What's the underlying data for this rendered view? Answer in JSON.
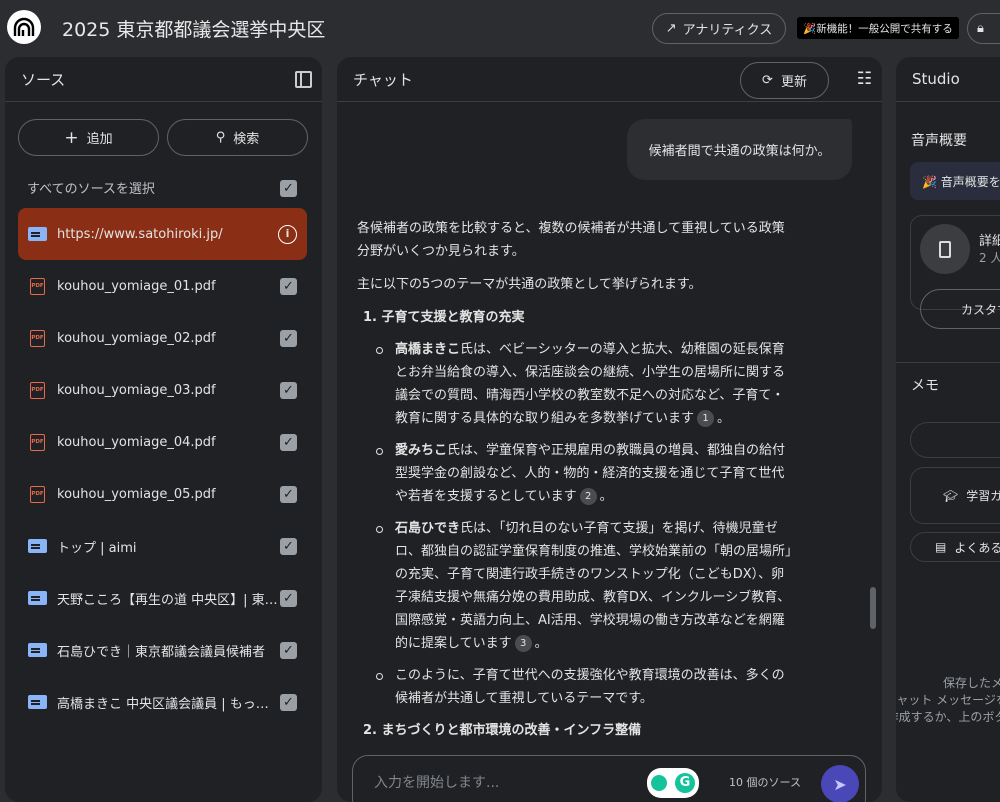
{
  "header": {
    "title": "2025 東京都都議会選挙中央区",
    "analytics": "アナリティクス",
    "new_feature": "🎉新機能！一般公開で共有する"
  },
  "sources": {
    "title": "ソース",
    "add": "追加",
    "search": "検索",
    "select_all": "すべてのソースを選択",
    "items": [
      {
        "type": "web",
        "label": "https://www.satohiroki.jp/",
        "selected": true
      },
      {
        "type": "pdf",
        "label": "kouhou_yomiage_01.pdf"
      },
      {
        "type": "pdf",
        "label": "kouhou_yomiage_02.pdf"
      },
      {
        "type": "pdf",
        "label": "kouhou_yomiage_03.pdf"
      },
      {
        "type": "pdf",
        "label": "kouhou_yomiage_04.pdf"
      },
      {
        "type": "pdf",
        "label": "kouhou_yomiage_05.pdf"
      },
      {
        "type": "web",
        "label": "トップ | aimi"
      },
      {
        "type": "web",
        "label": "天野こころ【再生の道 中央区】| 東京都議会議員候補"
      },
      {
        "type": "web",
        "label": "石島ひでき｜東京都議会議員候補者"
      },
      {
        "type": "web",
        "label": "高橋まきこ 中央区議会議員 | もっと中央区"
      }
    ]
  },
  "chat": {
    "title": "チャット",
    "refresh": "更新",
    "user_msg": "候補者間で共通の政策は何か。",
    "intro1": "各候補者の政策を比較すると、複数の候補者が共通して重視している政策分野がいくつか見られます。",
    "intro2": "主に以下の5つのテーマが共通の政策として挙げられます。",
    "h1": "1. 子育て支援と教育の充実",
    "b1_name": "高橋まきこ",
    "b1": "氏は、ベビーシッターの導入と拡大、幼稚園の延長保育とお弁当給食の導入、保活座談会の継続、小学生の居場所に関する議会での質問、晴海西小学校の教室数不足への対応など、子育て・教育に関する具体的な取り組みを多数挙げています",
    "c1": "1",
    "b2_name": "愛みちこ",
    "b2": "氏は、学童保育や正規雇用の教職員の増員、都独自の給付型奨学金の創設など、人的・物的・経済的支援を通じて子育て世代や若者を支援するとしています",
    "c2": "2",
    "b3_name": "石島ひでき",
    "b3": "氏は、「切れ目のない子育て支援」を掲げ、待機児童ゼロ、都独自の認証学童保育制度の推進、学校始業前の「朝の居場所」の充実、子育て関連行政手続きのワンストップ化（こどもDX）、卵子凍結支援や無痛分娩の費用助成、教育DX、インクルーシブ教育、国際感覚・英語力向上、AI活用、学校現場の働き方改革などを網羅的に提案しています",
    "c3": "3",
    "b4": "このように、子育て世代への支援強化や教育環境の改善は、多くの候補者が共通して重視しているテーマです。",
    "h2": "2. まちづくりと都市環境の改善・インフラ整備",
    "input_placeholder": "入力を開始します...",
    "source_count": "10 個のソース"
  },
  "studio": {
    "title": "Studio",
    "audio_title": "音声概要",
    "audio_banner": "🎉 音声概要を...",
    "detail": "詳細",
    "detail_sub": "2 人",
    "customize": "カスタマイズ",
    "memo": "メモ",
    "study": "学習ガイド",
    "faq": "よくある質問",
    "empty1": "保存したメモがここに表示されます",
    "empty2": "チャット メッセージを保存してメモを作成するか、上のボタンを使ってください"
  },
  "colors": {
    "selected_source": "#8a2f15",
    "send": "#4a47b8"
  }
}
